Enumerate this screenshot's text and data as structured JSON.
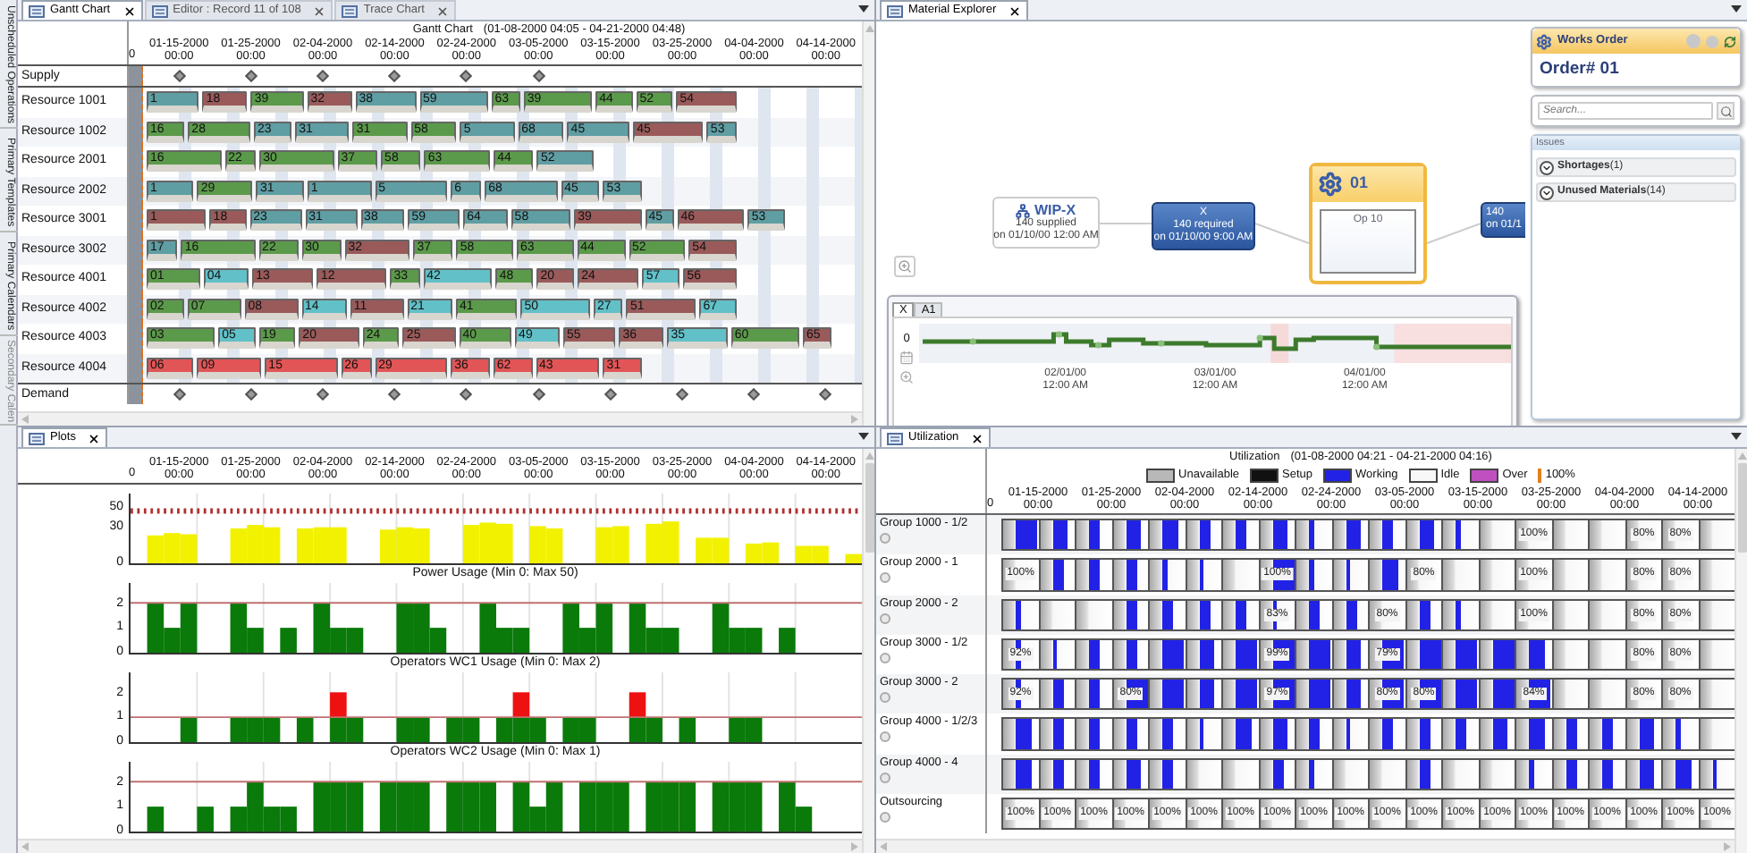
{
  "side_tabs": [
    {
      "label": "Unscheduled Operations"
    },
    {
      "label": "Primary Templates"
    },
    {
      "label": "Primary Calendars"
    },
    {
      "label": "Secondary Calen"
    }
  ],
  "gantt": {
    "tabs": [
      {
        "label": "Gantt Chart",
        "selected": true
      },
      {
        "label": "Editor : Record 11 of 108",
        "selected": false
      },
      {
        "label": "Trace Chart",
        "selected": false
      }
    ],
    "title": "Gantt Chart",
    "range": "(01-08-2000 04:05 - 04-21-2000 04:48)",
    "axis": {
      "start": "0",
      "ticks": [
        {
          "date": "01-15-2000",
          "time": "00:00"
        },
        {
          "date": "01-25-2000",
          "time": "00:00"
        },
        {
          "date": "02-04-2000",
          "time": "00:00"
        },
        {
          "date": "02-14-2000",
          "time": "00:00"
        },
        {
          "date": "02-24-2000",
          "time": "00:00"
        },
        {
          "date": "03-05-2000",
          "time": "00:00"
        },
        {
          "date": "03-15-2000",
          "time": "00:00"
        },
        {
          "date": "03-25-2000",
          "time": "00:00"
        },
        {
          "date": "04-04-2000",
          "time": "00:00"
        },
        {
          "date": "04-14-2000",
          "time": "00:00"
        }
      ]
    },
    "supply": {
      "label": "Supply"
    },
    "resources": [
      {
        "name": "Resource 1001",
        "bars": [
          {
            "label": "1",
            "color": "#5f9ea3"
          },
          {
            "label": "18",
            "color": "#9a5a5a"
          },
          {
            "label": "39",
            "color": "#5b9a4a"
          },
          {
            "label": "32",
            "color": "#9a5a5a"
          },
          {
            "label": "38",
            "color": "#5f9ea3"
          },
          {
            "label": "59",
            "color": "#5f9ea3"
          },
          {
            "label": "63",
            "color": "#5b9a4a"
          },
          {
            "label": "39",
            "color": "#5b9a4a"
          },
          {
            "label": "44",
            "color": "#5b9a4a"
          },
          {
            "label": "52",
            "color": "#5b9a4a"
          },
          {
            "label": "54",
            "color": "#9a5a5a"
          }
        ]
      },
      {
        "name": "Resource 1002",
        "bars": [
          {
            "label": "16",
            "color": "#5b9a4a"
          },
          {
            "label": "28",
            "color": "#5b9a4a"
          },
          {
            "label": "23",
            "color": "#5f9ea3"
          },
          {
            "label": "31",
            "color": "#5f9ea3"
          },
          {
            "label": "31",
            "color": "#5b9a4a"
          },
          {
            "label": "58",
            "color": "#5b9a4a"
          },
          {
            "label": "5",
            "color": "#5f9ea3"
          },
          {
            "label": "68",
            "color": "#5f9ea3"
          },
          {
            "label": "45",
            "color": "#5f9ea3"
          },
          {
            "label": "45",
            "color": "#9a5a5a"
          },
          {
            "label": "53",
            "color": "#5f9ea3"
          }
        ]
      },
      {
        "name": "Resource 2001",
        "bars": [
          {
            "label": "16",
            "color": "#5b9a4a"
          },
          {
            "label": "22",
            "color": "#5b9a4a"
          },
          {
            "label": "30",
            "color": "#5b9a4a"
          },
          {
            "label": "37",
            "color": "#5b9a4a"
          },
          {
            "label": "58",
            "color": "#5b9a4a"
          },
          {
            "label": "63",
            "color": "#5b9a4a"
          },
          {
            "label": "44",
            "color": "#5b9a4a"
          },
          {
            "label": "52",
            "color": "#5f9ea3"
          }
        ]
      },
      {
        "name": "Resource 2002",
        "bars": [
          {
            "label": "1",
            "color": "#5f9ea3"
          },
          {
            "label": "29",
            "color": "#5b9a4a"
          },
          {
            "label": "31",
            "color": "#5f9ea3"
          },
          {
            "label": "1",
            "color": "#5f9ea3"
          },
          {
            "label": "5",
            "color": "#5f9ea3"
          },
          {
            "label": "6",
            "color": "#5f9ea3"
          },
          {
            "label": "68",
            "color": "#5f9ea3"
          },
          {
            "label": "45",
            "color": "#5f9ea3"
          },
          {
            "label": "53",
            "color": "#5f9ea3"
          }
        ]
      },
      {
        "name": "Resource 3001",
        "bars": [
          {
            "label": "1",
            "color": "#9a5a5a"
          },
          {
            "label": "18",
            "color": "#9a5a5a"
          },
          {
            "label": "23",
            "color": "#5f9ea3"
          },
          {
            "label": "31",
            "color": "#5f9ea3"
          },
          {
            "label": "38",
            "color": "#5f9ea3"
          },
          {
            "label": "59",
            "color": "#5f9ea3"
          },
          {
            "label": "64",
            "color": "#5f9ea3"
          },
          {
            "label": "58",
            "color": "#5f9ea3"
          },
          {
            "label": "39",
            "color": "#9a5a5a"
          },
          {
            "label": "45",
            "color": "#5f9ea3"
          },
          {
            "label": "46",
            "color": "#9a5a5a"
          },
          {
            "label": "53",
            "color": "#5f9ea3"
          }
        ]
      },
      {
        "name": "Resource 3002",
        "bars": [
          {
            "label": "17",
            "color": "#5f9ea3"
          },
          {
            "label": "16",
            "color": "#5b9a4a"
          },
          {
            "label": "22",
            "color": "#5b9a4a"
          },
          {
            "label": "30",
            "color": "#5b9a4a"
          },
          {
            "label": "32",
            "color": "#9a5a5a"
          },
          {
            "label": "37",
            "color": "#5b9a4a"
          },
          {
            "label": "58",
            "color": "#5b9a4a"
          },
          {
            "label": "63",
            "color": "#5b9a4a"
          },
          {
            "label": "44",
            "color": "#5b9a4a"
          },
          {
            "label": "52",
            "color": "#5b9a4a"
          },
          {
            "label": "54",
            "color": "#9a5a5a"
          }
        ]
      },
      {
        "name": "Resource 4001",
        "bars": [
          {
            "label": "01",
            "color": "#5b9a4a"
          },
          {
            "label": "04",
            "color": "#62c0c8"
          },
          {
            "label": "13",
            "color": "#9a5a5a"
          },
          {
            "label": "12",
            "color": "#9a5a5a"
          },
          {
            "label": "33",
            "color": "#5b9a4a"
          },
          {
            "label": "42",
            "color": "#62c0c8"
          },
          {
            "label": "48",
            "color": "#5b9a4a"
          },
          {
            "label": "20",
            "color": "#9a5a5a"
          },
          {
            "label": "24",
            "color": "#9a5a5a"
          },
          {
            "label": "57",
            "color": "#62c0c8"
          },
          {
            "label": "56",
            "color": "#9a5a5a"
          }
        ]
      },
      {
        "name": "Resource 4002",
        "bars": [
          {
            "label": "02",
            "color": "#5b9a4a"
          },
          {
            "label": "07",
            "color": "#5b9a4a"
          },
          {
            "label": "08",
            "color": "#9a5a5a"
          },
          {
            "label": "14",
            "color": "#62c0c8"
          },
          {
            "label": "11",
            "color": "#9a5a5a"
          },
          {
            "label": "21",
            "color": "#62c0c8"
          },
          {
            "label": "41",
            "color": "#5b9a4a"
          },
          {
            "label": "50",
            "color": "#62c0c8"
          },
          {
            "label": "27",
            "color": "#62c0c8"
          },
          {
            "label": "51",
            "color": "#9a5a5a"
          },
          {
            "label": "67",
            "color": "#62c0c8"
          }
        ]
      },
      {
        "name": "Resource 4003",
        "bars": [
          {
            "label": "03",
            "color": "#5b9a4a"
          },
          {
            "label": "05",
            "color": "#62c0c8"
          },
          {
            "label": "19",
            "color": "#5b9a4a"
          },
          {
            "label": "20",
            "color": "#9a5a5a"
          },
          {
            "label": "24",
            "color": "#5b9a4a"
          },
          {
            "label": "25",
            "color": "#9a5a5a"
          },
          {
            "label": "40",
            "color": "#5b9a4a"
          },
          {
            "label": "49",
            "color": "#62c0c8"
          },
          {
            "label": "55",
            "color": "#9a5a5a"
          },
          {
            "label": "36",
            "color": "#9a5a5a"
          },
          {
            "label": "35",
            "color": "#62c0c8"
          },
          {
            "label": "60",
            "color": "#5b9a4a"
          },
          {
            "label": "65",
            "color": "#9a5a5a"
          }
        ]
      },
      {
        "name": "Resource 4004",
        "bars": [
          {
            "label": "06",
            "color": "#e25557"
          },
          {
            "label": "09",
            "color": "#e25557"
          },
          {
            "label": "15",
            "color": "#e25557"
          },
          {
            "label": "26",
            "color": "#e25557"
          },
          {
            "label": "29",
            "color": "#e25557"
          },
          {
            "label": "36",
            "color": "#e25557"
          },
          {
            "label": "62",
            "color": "#e25557"
          },
          {
            "label": "43",
            "color": "#e25557"
          },
          {
            "label": "31",
            "color": "#e25557"
          }
        ]
      }
    ],
    "demand": {
      "label": "Demand"
    }
  },
  "plots": {
    "tabs": [
      {
        "label": "Plots",
        "selected": true
      }
    ],
    "axis": {
      "start": "0",
      "ticks": [
        {
          "date": "01-15-2000",
          "time": "00:00"
        },
        {
          "date": "01-25-2000",
          "time": "00:00"
        },
        {
          "date": "02-04-2000",
          "time": "00:00"
        },
        {
          "date": "02-14-2000",
          "time": "00:00"
        },
        {
          "date": "02-24-2000",
          "time": "00:00"
        },
        {
          "date": "03-05-2000",
          "time": "00:00"
        },
        {
          "date": "03-15-2000",
          "time": "00:00"
        },
        {
          "date": "03-25-2000",
          "time": "00:00"
        },
        {
          "date": "04-04-2000",
          "time": "00:00"
        },
        {
          "date": "04-14-2000",
          "time": "00:00"
        }
      ]
    },
    "charts": [
      {
        "kind": "power",
        "title": "Power Usage (Min 0: Max 50)",
        "y_ticks": [
          "50",
          "30",
          "0"
        ]
      },
      {
        "kind": "usage",
        "title": "Operators WC1 Usage (Min 0: Max 2)",
        "y_ticks": [
          "2",
          "1",
          "0"
        ]
      },
      {
        "kind": "overload",
        "title": "Operators WC2 Usage (Min 0: Max 1)",
        "y_ticks": [
          "2",
          "1",
          "0"
        ]
      },
      {
        "kind": "usage",
        "y_ticks": [
          "2",
          "1",
          "0"
        ]
      }
    ]
  },
  "material": {
    "tabs": [
      {
        "label": "Material Explorer",
        "selected": true
      }
    ],
    "nodes": [
      {
        "kind": "supply",
        "title": "WIP-X",
        "lines": [
          "140 supplied",
          "on 01/10/00 12:00 AM"
        ]
      },
      {
        "kind": "requirement",
        "title": "X",
        "lines": [
          "140 required",
          "on 01/10/00 9:00 AM"
        ]
      },
      {
        "kind": "operation",
        "title": "01",
        "lines": [
          "Op 10"
        ]
      },
      {
        "kind": "requirement",
        "lines": [
          "140",
          "on 01/1"
        ]
      }
    ],
    "chart": {
      "tabs": [
        {
          "label": "X",
          "selected": true
        },
        {
          "label": "A1",
          "selected": false
        }
      ],
      "y_label": "0",
      "x_labels": [
        {
          "date": "02/01/00",
          "time": "12:00 AM"
        },
        {
          "date": "03/01/00",
          "time": "12:00 AM"
        },
        {
          "date": "04/01/00",
          "time": "12:00 AM"
        }
      ]
    }
  },
  "works_order": {
    "title": "Works Order",
    "order": "Order# 01",
    "search": {
      "placeholder": "Search..."
    },
    "issues": {
      "title": "Issues",
      "items": [
        {
          "label": "**Shortages**(1)",
          "expanded": false
        },
        {
          "label": "**Unused Materials**(14)",
          "expanded": false
        }
      ]
    }
  },
  "utilization": {
    "tabs": [
      {
        "label": "Utilization",
        "selected": true
      }
    ],
    "title": "Utilization",
    "range": "(01-08-2000 04:21 - 04-21-2000 04:16)",
    "legend": [
      {
        "kind": "swatch",
        "label": "Unavailable",
        "color": "#b8b8b8"
      },
      {
        "kind": "swatch",
        "label": "Setup",
        "color": "#111111"
      },
      {
        "kind": "swatch",
        "label": "Working",
        "color": "#2222e6"
      },
      {
        "kind": "swatch",
        "label": "Idle",
        "color": "#f8f8f8"
      },
      {
        "kind": "swatch",
        "label": "Over",
        "color": "#c050c0"
      },
      {
        "kind": "marker",
        "label": "100%",
        "color": "#e08020"
      }
    ],
    "axis": {
      "start": "0",
      "ticks": [
        {
          "date": "01-15-2000",
          "time": "00:00"
        },
        {
          "date": "01-25-2000",
          "time": "00:00"
        },
        {
          "date": "02-04-2000",
          "time": "00:00"
        },
        {
          "date": "02-14-2000",
          "time": "00:00"
        },
        {
          "date": "02-24-2000",
          "time": "00:00"
        },
        {
          "date": "03-05-2000",
          "time": "00:00"
        },
        {
          "date": "03-15-2000",
          "time": "00:00"
        },
        {
          "date": "03-25-2000",
          "time": "00:00"
        },
        {
          "date": "04-04-2000",
          "time": "00:00"
        },
        {
          "date": "04-14-2000",
          "time": "00:00"
        }
      ]
    },
    "rows": [
      {
        "name": "Group 1000 - 1/2",
        "cells": [
          {
            "kind": "full"
          },
          {
            "kind": "high"
          },
          {
            "kind": "half"
          },
          {
            "kind": "high"
          },
          {
            "kind": "high"
          },
          {
            "kind": "half"
          },
          {
            "kind": "half"
          },
          {
            "kind": "high"
          },
          {
            "kind": "low"
          },
          {
            "kind": "high"
          },
          {
            "kind": "half"
          },
          {
            "kind": "high"
          },
          {
            "kind": "low"
          },
          {
            "kind": "none"
          },
          {
            "kind": "none",
            "label": "100%"
          },
          {
            "kind": "none"
          },
          {
            "kind": "none"
          },
          {
            "kind": "none",
            "label": "80%"
          },
          {
            "kind": "none",
            "label": "80%"
          },
          {
            "kind": "none"
          }
        ]
      },
      {
        "name": "Group 2000 - 1",
        "cells": [
          {
            "kind": "none",
            "label": "100%"
          },
          {
            "kind": "half"
          },
          {
            "kind": "half"
          },
          {
            "kind": "half"
          },
          {
            "kind": "low"
          },
          {
            "kind": "low"
          },
          {
            "kind": "none"
          },
          {
            "kind": "full",
            "label": "100%"
          },
          {
            "kind": "low"
          },
          {
            "kind": "low"
          },
          {
            "kind": "high"
          },
          {
            "kind": "none",
            "label": "80%"
          },
          {
            "kind": "none"
          },
          {
            "kind": "none"
          },
          {
            "kind": "none",
            "label": "100%"
          },
          {
            "kind": "none"
          },
          {
            "kind": "none"
          },
          {
            "kind": "none",
            "label": "80%"
          },
          {
            "kind": "none",
            "label": "80%"
          },
          {
            "kind": "none"
          }
        ]
      },
      {
        "name": "Group 2000 - 2",
        "cells": [
          {
            "kind": "low"
          },
          {
            "kind": "none"
          },
          {
            "kind": "none"
          },
          {
            "kind": "half"
          },
          {
            "kind": "half"
          },
          {
            "kind": "half"
          },
          {
            "kind": "half"
          },
          {
            "kind": "low",
            "label": "83%"
          },
          {
            "kind": "half"
          },
          {
            "kind": "half"
          },
          {
            "kind": "none",
            "label": "80%"
          },
          {
            "kind": "half"
          },
          {
            "kind": "low"
          },
          {
            "kind": "none"
          },
          {
            "kind": "none",
            "label": "100%"
          },
          {
            "kind": "none"
          },
          {
            "kind": "none"
          },
          {
            "kind": "none",
            "label": "80%"
          },
          {
            "kind": "none",
            "label": "80%"
          },
          {
            "kind": "none"
          }
        ]
      },
      {
        "name": "Group 3000 - 1/2",
        "cells": [
          {
            "kind": "low",
            "label": "92%"
          },
          {
            "kind": "low"
          },
          {
            "kind": "half"
          },
          {
            "kind": "half"
          },
          {
            "kind": "full"
          },
          {
            "kind": "high"
          },
          {
            "kind": "full"
          },
          {
            "kind": "full",
            "label": "99%"
          },
          {
            "kind": "full"
          },
          {
            "kind": "high"
          },
          {
            "kind": "full",
            "label": "79%"
          },
          {
            "kind": "full"
          },
          {
            "kind": "full"
          },
          {
            "kind": "full"
          },
          {
            "kind": "high"
          },
          {
            "kind": "none"
          },
          {
            "kind": "none"
          },
          {
            "kind": "none",
            "label": "80%"
          },
          {
            "kind": "none",
            "label": "80%"
          },
          {
            "kind": "none"
          }
        ]
      },
      {
        "name": "Group 3000 - 2",
        "cells": [
          {
            "kind": "low",
            "label": "92%"
          },
          {
            "kind": "half"
          },
          {
            "kind": "half"
          },
          {
            "kind": "full",
            "label": "80%"
          },
          {
            "kind": "full"
          },
          {
            "kind": "high"
          },
          {
            "kind": "full"
          },
          {
            "kind": "full",
            "label": "97%"
          },
          {
            "kind": "full"
          },
          {
            "kind": "high"
          },
          {
            "kind": "full",
            "label": "80%"
          },
          {
            "kind": "full",
            "label": "80%"
          },
          {
            "kind": "full"
          },
          {
            "kind": "full"
          },
          {
            "kind": "full",
            "label": "84%"
          },
          {
            "kind": "none"
          },
          {
            "kind": "none"
          },
          {
            "kind": "none",
            "label": "80%"
          },
          {
            "kind": "none",
            "label": "80%"
          },
          {
            "kind": "none"
          }
        ]
      },
      {
        "name": "Group 4000 - 1/2/3",
        "cells": [
          {
            "kind": "high"
          },
          {
            "kind": "half"
          },
          {
            "kind": "half"
          },
          {
            "kind": "half"
          },
          {
            "kind": "half"
          },
          {
            "kind": "low"
          },
          {
            "kind": "high"
          },
          {
            "kind": "high"
          },
          {
            "kind": "half"
          },
          {
            "kind": "low"
          },
          {
            "kind": "half"
          },
          {
            "kind": "half"
          },
          {
            "kind": "half"
          },
          {
            "kind": "high"
          },
          {
            "kind": "high"
          },
          {
            "kind": "half"
          },
          {
            "kind": "half"
          },
          {
            "kind": "high"
          },
          {
            "kind": "low"
          },
          {
            "kind": "none"
          }
        ]
      },
      {
        "name": "Group 4000 - 4",
        "cells": [
          {
            "kind": "high"
          },
          {
            "kind": "half"
          },
          {
            "kind": "half"
          },
          {
            "kind": "high"
          },
          {
            "kind": "half"
          },
          {
            "kind": "none"
          },
          {
            "kind": "none"
          },
          {
            "kind": "half"
          },
          {
            "kind": "low"
          },
          {
            "kind": "none"
          },
          {
            "kind": "none"
          },
          {
            "kind": "half"
          },
          {
            "kind": "none"
          },
          {
            "kind": "none"
          },
          {
            "kind": "low"
          },
          {
            "kind": "half"
          },
          {
            "kind": "half"
          },
          {
            "kind": "high"
          },
          {
            "kind": "high"
          },
          {
            "kind": "low"
          }
        ]
      },
      {
        "name": "Outsourcing",
        "cells": [
          {
            "kind": "none",
            "label": "100%"
          },
          {
            "kind": "none",
            "label": "100%"
          },
          {
            "kind": "none",
            "label": "100%"
          },
          {
            "kind": "none",
            "label": "100%"
          },
          {
            "kind": "none",
            "label": "100%"
          },
          {
            "kind": "none",
            "label": "100%"
          },
          {
            "kind": "none",
            "label": "100%"
          },
          {
            "kind": "none",
            "label": "100%"
          },
          {
            "kind": "none",
            "label": "100%"
          },
          {
            "kind": "none",
            "label": "100%"
          },
          {
            "kind": "none",
            "label": "100%"
          },
          {
            "kind": "none",
            "label": "100%"
          },
          {
            "kind": "none",
            "label": "100%"
          },
          {
            "kind": "none",
            "label": "100%"
          },
          {
            "kind": "none",
            "label": "100%"
          },
          {
            "kind": "none",
            "label": "100%"
          },
          {
            "kind": "none",
            "label": "100%"
          },
          {
            "kind": "none",
            "label": "100%"
          },
          {
            "kind": "none",
            "label": "100%"
          },
          {
            "kind": "none",
            "label": "100%"
          }
        ]
      }
    ]
  }
}
